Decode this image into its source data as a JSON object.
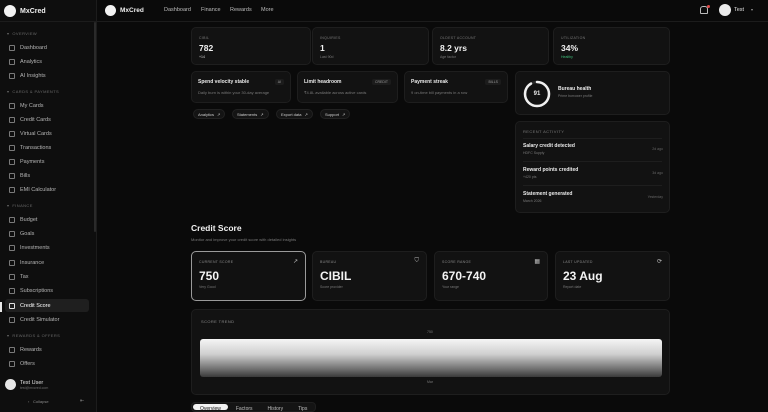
{
  "app": {
    "name": "MxCred"
  },
  "topnav": {
    "links": [
      "Dashboard",
      "Finance",
      "Rewards",
      "More"
    ],
    "user_label": "Test"
  },
  "sidebar": {
    "sections": [
      {
        "title": "OVERVIEW",
        "items": [
          "Dashboard",
          "Analytics",
          "AI Insights"
        ]
      },
      {
        "title": "CARDS & PAYMENTS",
        "items": [
          "My Cards",
          "Credit Cards",
          "Virtual Cards",
          "Transactions",
          "Payments",
          "Bills",
          "EMI Calculator"
        ]
      },
      {
        "title": "FINANCE",
        "items": [
          "Budget",
          "Goals",
          "Investments",
          "Insurance",
          "Tax",
          "Subscriptions",
          "Credit Score",
          "Credit Simulator"
        ]
      },
      {
        "title": "REWARDS & OFFERS",
        "items": [
          "Rewards",
          "Offers"
        ]
      }
    ],
    "active_item": "Credit Score",
    "user": {
      "name": "Test User",
      "email": "test@mxcred.com"
    },
    "collapse_label": "Collapse"
  },
  "kpis": [
    {
      "label": "CIBIL",
      "value": "782",
      "sub": "+14"
    },
    {
      "label": "INQUIRIES",
      "value": "1",
      "sub": "Last 90d"
    },
    {
      "label": "OLDEST ACCOUNT",
      "value": "8.2 yrs",
      "sub": "Age factor"
    },
    {
      "label": "UTILIZATION",
      "value": "34%",
      "sub": "Healthy"
    }
  ],
  "insights": [
    {
      "title": "Spend velocity stable",
      "tag": "AI",
      "desc": "Daily burn is within your 30-day average"
    },
    {
      "title": "Limit headroom",
      "tag": "CREDIT",
      "desc": "₹4.8L available across active cards"
    },
    {
      "title": "Payment streak",
      "tag": "BILLS",
      "desc": "9 on-time bill payments in a row"
    }
  ],
  "chips": [
    "Analytics",
    "Statements",
    "Export data",
    "Support"
  ],
  "bureau": {
    "score": "91",
    "title": "Bureau health",
    "sub": "Prime borrower profile"
  },
  "recent_activity": {
    "title": "RECENT ACTIVITY",
    "items": [
      {
        "title": "Salary credit detected",
        "sub": "HDFC Supply",
        "time": "2d ago"
      },
      {
        "title": "Reward points credited",
        "sub": "+420 pts",
        "time": "3d ago"
      },
      {
        "title": "Statement generated",
        "sub": "March 2026",
        "time": "Yesterday"
      }
    ]
  },
  "credit_score": {
    "title": "Credit Score",
    "subtitle": "Monitor and improve your credit score with detailed insights",
    "cards": [
      {
        "label": "CURRENT SCORE",
        "value": "750",
        "sub": "Very Good",
        "icon": "trend-up-icon"
      },
      {
        "label": "BUREAU",
        "value": "CIBIL",
        "sub": "Score provider",
        "icon": "shield-icon"
      },
      {
        "label": "SCORE RANGE",
        "value": "670-740",
        "sub": "Your range",
        "icon": "calendar-icon"
      },
      {
        "label": "LAST UPDATED",
        "value": "23 Aug",
        "sub": "Report date",
        "icon": "refresh-icon"
      }
    ],
    "trend": {
      "label": "SCORE TREND",
      "max_label": "750",
      "min_label": "Mar"
    },
    "tabs": [
      "Overview",
      "Factors",
      "History",
      "Tips"
    ],
    "active_tab": "Overview"
  },
  "colors": {
    "accent": "#f2f2f2",
    "good": "#3fbf7a",
    "alert": "#e04848",
    "background": "#0a0a0a"
  }
}
